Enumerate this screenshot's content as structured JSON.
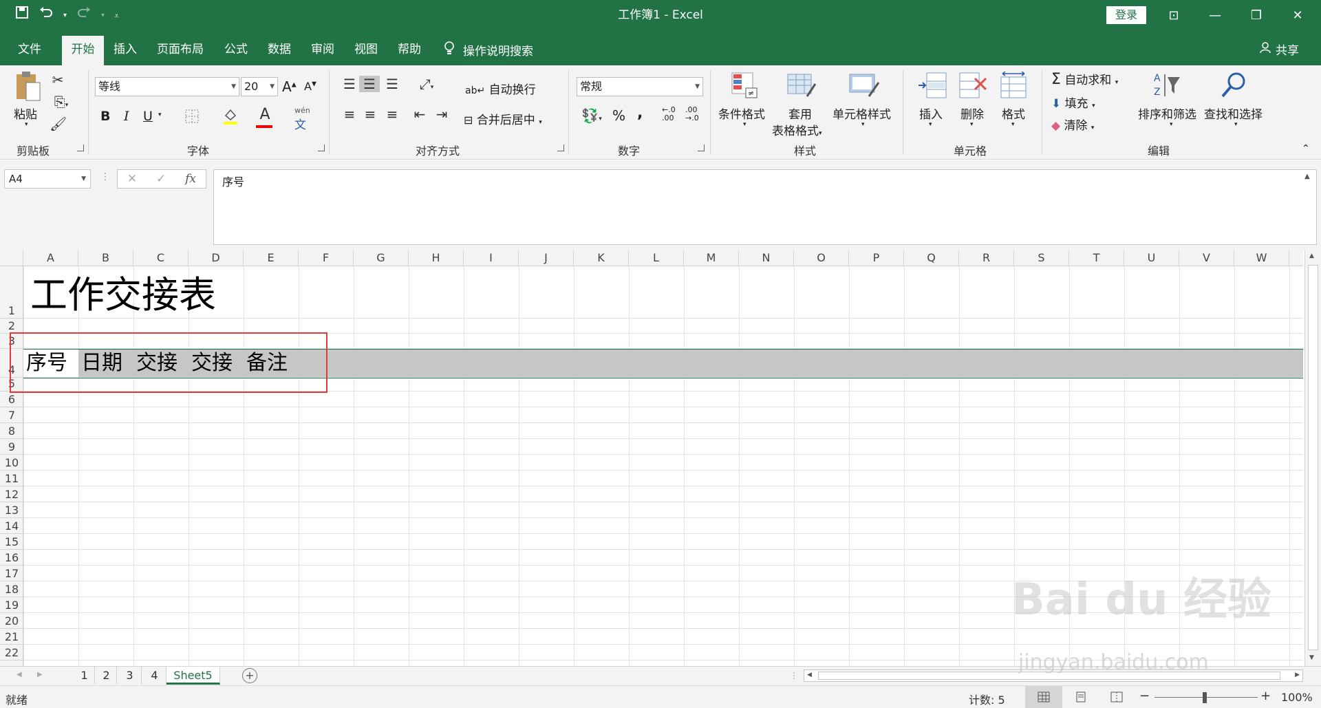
{
  "app": {
    "title": "工作簿1  -  Excel",
    "login": "登录"
  },
  "qat": {
    "save_icon": "save-icon",
    "undo_icon": "undo-icon",
    "redo_icon": "redo-icon"
  },
  "window": {
    "minimize": "—",
    "restore": "❐",
    "close": "✕",
    "ribbon_display": "⊡"
  },
  "tabs": [
    {
      "label": "文件"
    },
    {
      "label": "开始"
    },
    {
      "label": "插入"
    },
    {
      "label": "页面布局"
    },
    {
      "label": "公式"
    },
    {
      "label": "数据"
    },
    {
      "label": "审阅"
    },
    {
      "label": "视图"
    },
    {
      "label": "帮助"
    }
  ],
  "tell_me": "操作说明搜索",
  "share": "共享",
  "ribbon": {
    "clipboard": {
      "label": "剪贴板",
      "paste": "粘贴"
    },
    "font": {
      "label": "字体",
      "name": "等线",
      "size": "20",
      "bold": "B",
      "italic": "I",
      "underline": "U",
      "increase": "A",
      "decrease": "A",
      "phonetic_top": "wén",
      "phonetic_bottom": "文"
    },
    "alignment": {
      "label": "对齐方式",
      "wrap": "自动换行",
      "merge": "合并后居中"
    },
    "number": {
      "label": "数字",
      "format": "常规",
      "percent": "%",
      "comma": ",",
      "inc_dec": "←.0\n.00",
      "dec_dec": ".00\n→.0"
    },
    "styles": {
      "label": "样式",
      "conditional": "条件格式",
      "table_top": "套用",
      "table_bottom": "表格格式",
      "cell_styles": "单元格样式"
    },
    "cells": {
      "label": "单元格",
      "insert": "插入",
      "delete": "删除",
      "format": "格式"
    },
    "editing": {
      "label": "编辑",
      "autosum": "自动求和",
      "fill": "填充",
      "clear": "清除",
      "sort": "排序和筛选",
      "find": "查找和选择"
    }
  },
  "formula_bar": {
    "name_box": "A4",
    "fx": "fx",
    "content": "序号"
  },
  "columns": [
    "A",
    "B",
    "C",
    "D",
    "E",
    "F",
    "G",
    "H",
    "I",
    "J",
    "K",
    "L",
    "M",
    "N",
    "O",
    "P",
    "Q",
    "R",
    "S",
    "T",
    "U",
    "V",
    "W"
  ],
  "rows": [
    "1",
    "2",
    "3",
    "4",
    "5",
    "6",
    "7",
    "8",
    "9",
    "10",
    "11",
    "12",
    "13",
    "14",
    "15",
    "16",
    "17",
    "18",
    "19",
    "20",
    "21",
    "22"
  ],
  "cells": {
    "title": "工作交接表",
    "headers": [
      "序号",
      "日期",
      "交接",
      "交接",
      "备注"
    ]
  },
  "sheets": [
    "1",
    "2",
    "3",
    "4",
    "Sheet5"
  ],
  "status": {
    "ready": "就绪",
    "count": "计数: 5",
    "zoom": "100%"
  },
  "watermark": {
    "logo": "Bai du 经验",
    "url": "jingyan.baidu.com"
  },
  "colors": {
    "accent": "#217346",
    "highlight": "#e03a3a",
    "header_row": "#c6c6c6"
  }
}
